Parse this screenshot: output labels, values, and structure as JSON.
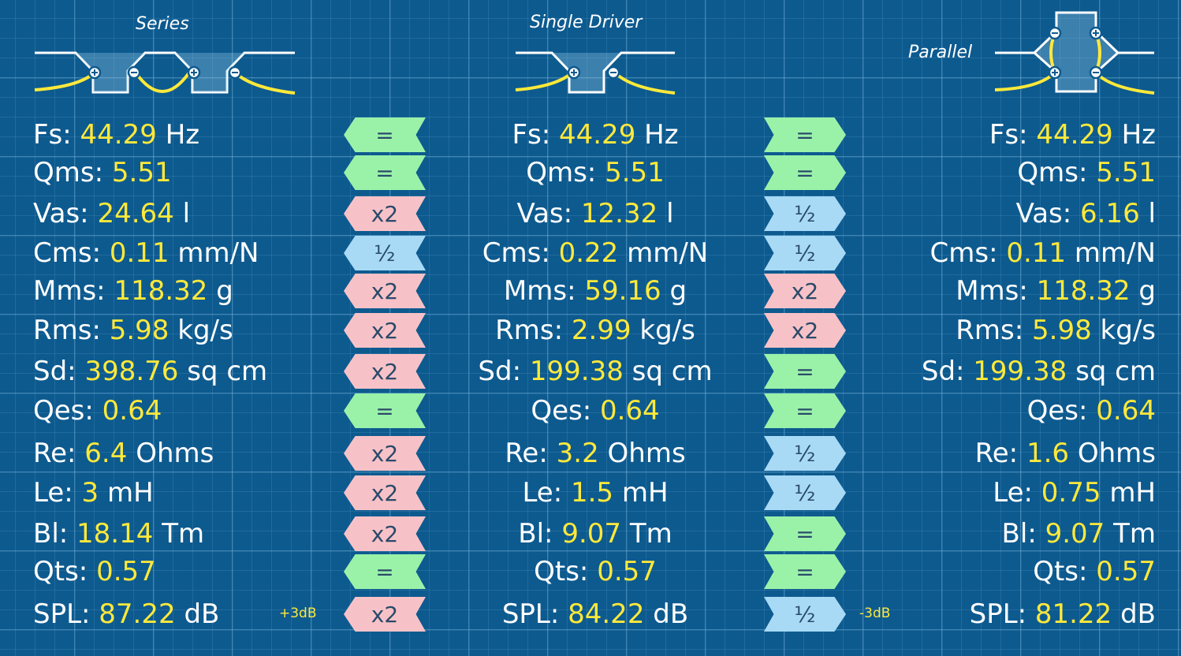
{
  "headings": {
    "series": "Series",
    "single": "Single Driver",
    "parallel": "Parallel"
  },
  "colors": {
    "background": "#0d5a8f",
    "value": "#ffe93a",
    "equal": "#9af2a9",
    "double": "#f7c2c7",
    "half": "#a8daf6"
  },
  "rows": [
    {
      "label": "Fs:",
      "series": "44.29",
      "s_unit": "Hz",
      "single": "44.29",
      "m_unit": "Hz",
      "parallel": "44.29",
      "p_unit": "Hz",
      "left_op": "=",
      "right_op": "="
    },
    {
      "label": "Qms:",
      "series": "5.51",
      "s_unit": "",
      "single": "5.51",
      "m_unit": "",
      "parallel": "5.51",
      "p_unit": "",
      "left_op": "=",
      "right_op": "="
    },
    {
      "label": "Vas:",
      "series": "24.64",
      "s_unit": "l",
      "single": "12.32",
      "m_unit": "l",
      "parallel": "6.16",
      "p_unit": "l",
      "left_op": "x2",
      "right_op": "½"
    },
    {
      "label": "Cms:",
      "series": "0.11",
      "s_unit": "mm/N",
      "single": "0.22",
      "m_unit": "mm/N",
      "parallel": "0.11",
      "p_unit": "mm/N",
      "left_op": "½",
      "right_op": "½"
    },
    {
      "label": "Mms:",
      "series": "118.32",
      "s_unit": "g",
      "single": "59.16",
      "m_unit": "g",
      "parallel": "118.32",
      "p_unit": "g",
      "left_op": "x2",
      "right_op": "x2"
    },
    {
      "label": "Rms:",
      "series": "5.98",
      "s_unit": "kg/s",
      "single": "2.99",
      "m_unit": "kg/s",
      "parallel": "5.98",
      "p_unit": "kg/s",
      "left_op": "x2",
      "right_op": "x2"
    },
    {
      "label": "Sd:",
      "series": "398.76",
      "s_unit": "sq cm",
      "single": "199.38",
      "m_unit": "sq cm",
      "parallel": "199.38",
      "p_unit": "sq cm",
      "left_op": "x2",
      "right_op": "="
    },
    {
      "label": "Qes:",
      "series": "0.64",
      "s_unit": "",
      "single": "0.64",
      "m_unit": "",
      "parallel": "0.64",
      "p_unit": "",
      "left_op": "=",
      "right_op": "="
    },
    {
      "label": "Re:",
      "series": "6.4",
      "s_unit": "Ohms",
      "single": "3.2",
      "m_unit": "Ohms",
      "parallel": "1.6",
      "p_unit": "Ohms",
      "left_op": "x2",
      "right_op": "½"
    },
    {
      "label": "Le:",
      "series": "3",
      "s_unit": "mH",
      "single": "1.5",
      "m_unit": "mH",
      "parallel": "0.75",
      "p_unit": "mH",
      "left_op": "x2",
      "right_op": "½"
    },
    {
      "label": "Bl:",
      "series": "18.14",
      "s_unit": "Tm",
      "single": "9.07",
      "m_unit": "Tm",
      "parallel": "9.07",
      "p_unit": "Tm",
      "left_op": "x2",
      "right_op": "="
    },
    {
      "label": "Qts:",
      "series": "0.57",
      "s_unit": "",
      "single": "0.57",
      "m_unit": "",
      "parallel": "0.57",
      "p_unit": "",
      "left_op": "=",
      "right_op": "="
    },
    {
      "label": "SPL:",
      "series": "87.22",
      "s_unit": "dB",
      "single": "84.22",
      "m_unit": "dB",
      "parallel": "81.22",
      "p_unit": "dB",
      "left_op": "x2",
      "right_op": "½"
    }
  ],
  "spl_notes": {
    "series": "+3dB",
    "parallel": "-3dB"
  }
}
